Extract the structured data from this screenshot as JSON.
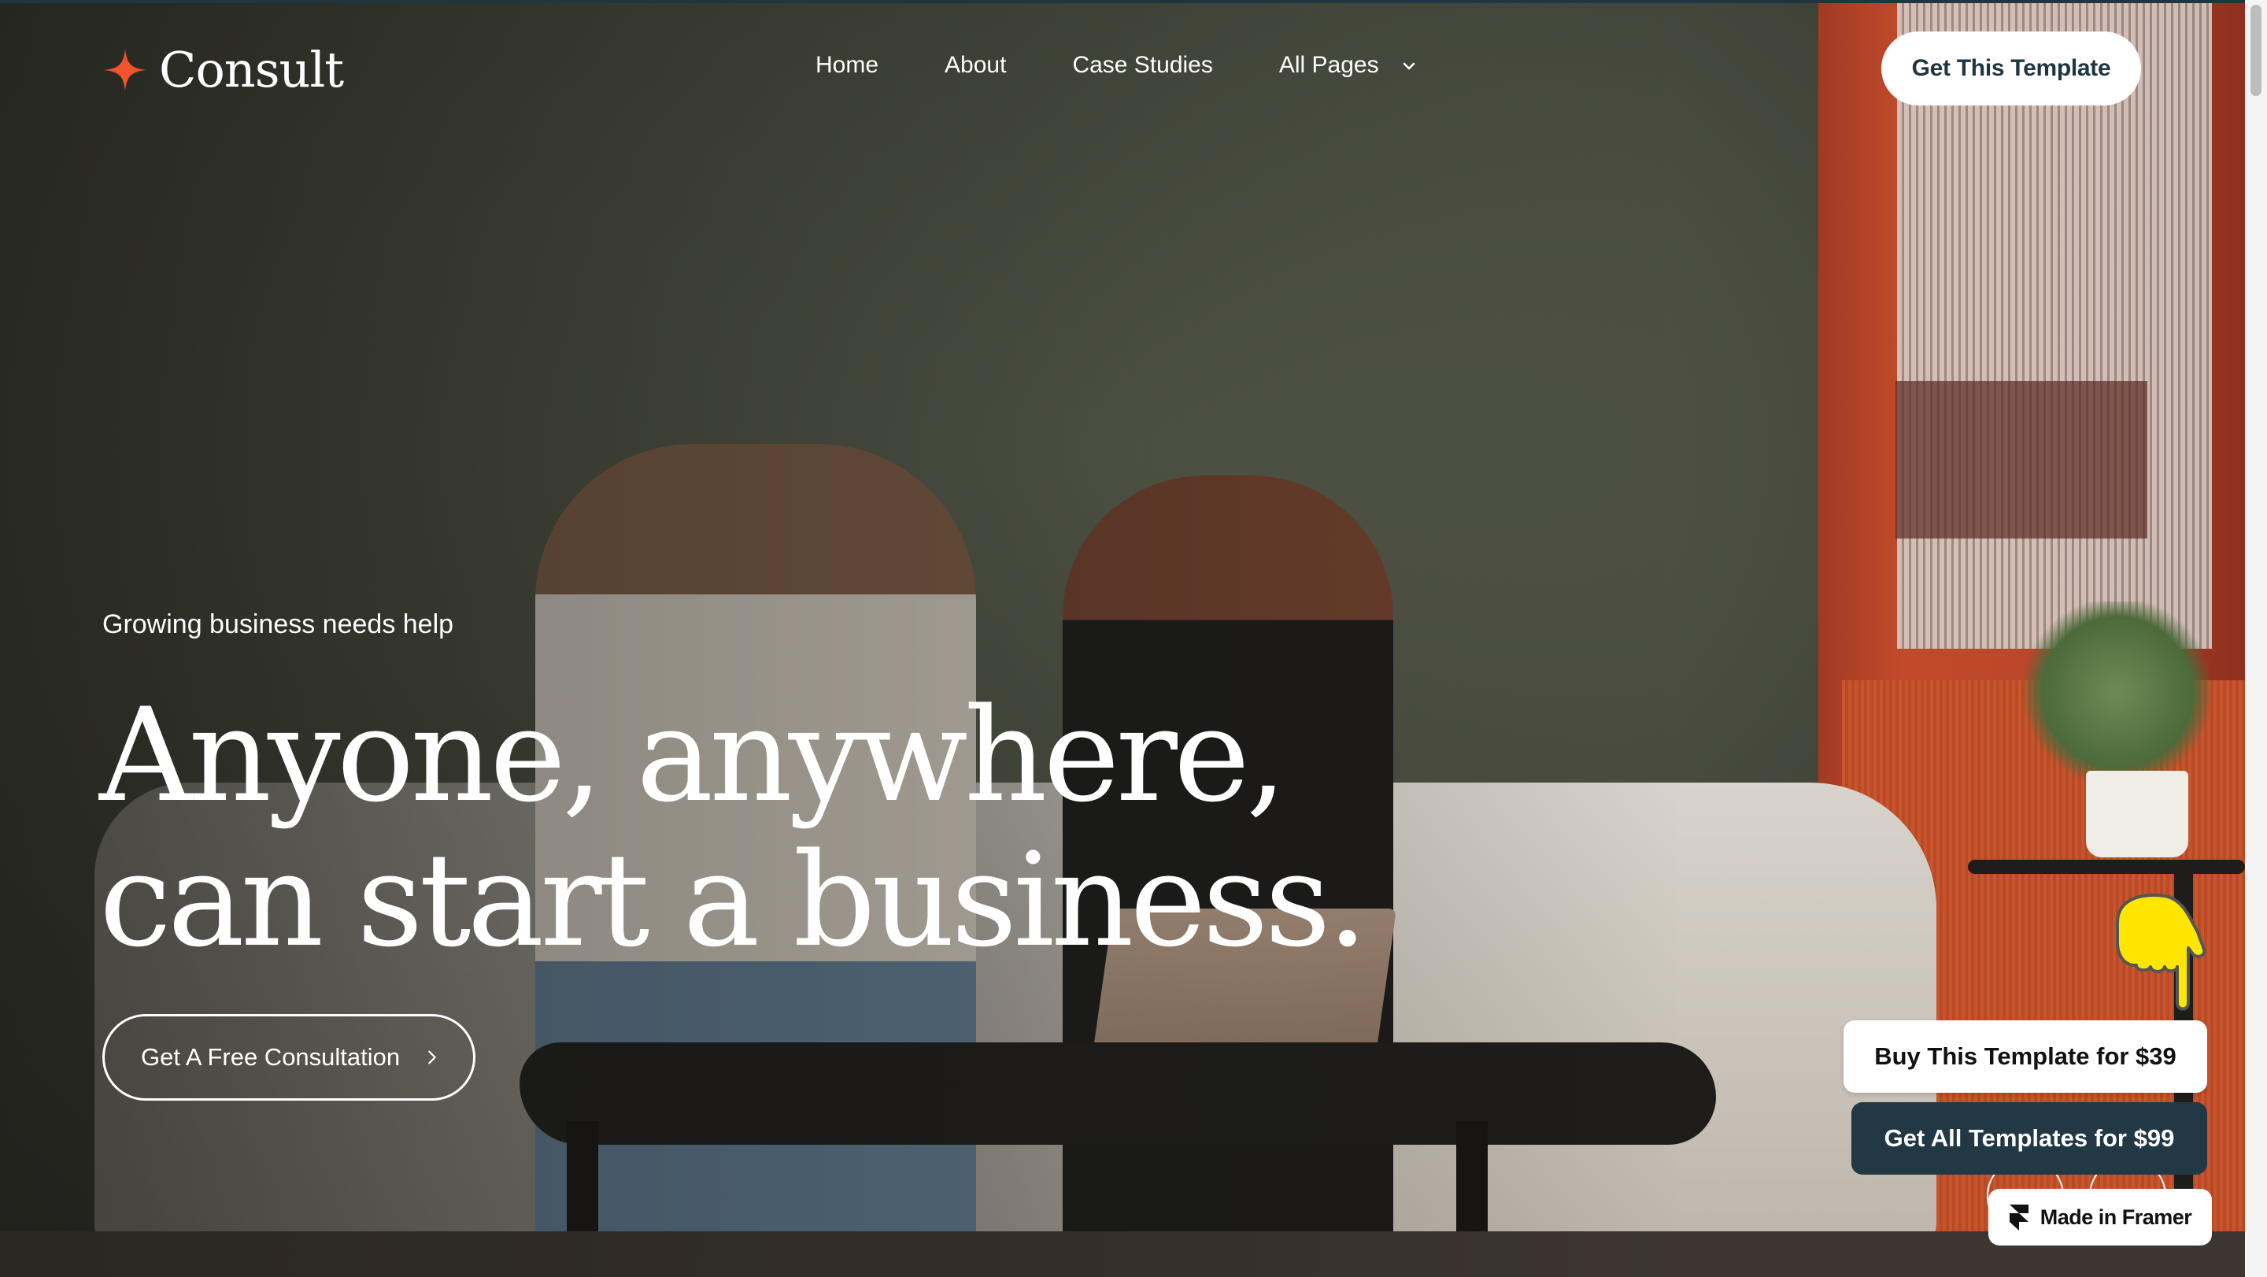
{
  "brand": {
    "name": "Consult",
    "accent_color": "#f0532d"
  },
  "nav": {
    "items": [
      {
        "label": "Home"
      },
      {
        "label": "About"
      },
      {
        "label": "Case Studies"
      },
      {
        "label": "All Pages",
        "has_dropdown": true
      }
    ],
    "cta_label": "Get This Template"
  },
  "hero": {
    "eyebrow": "Growing business needs help",
    "headline_line1": "Anyone, anywhere,",
    "headline_line2": "can start a business.",
    "cta_label": "Get A Free Consultation",
    "cta_icon": "chevron-right-icon"
  },
  "promo": {
    "buy_label": "Buy This Template for $39",
    "get_all_label": "Get All Templates for $99",
    "made_in_label": "Made in Framer",
    "dark_color": "#223845",
    "hand_icon": "pointing-down-hand-icon"
  },
  "carousel": {
    "prev_icon": "arrow-left-icon",
    "next_icon": "arrow-right-icon"
  }
}
